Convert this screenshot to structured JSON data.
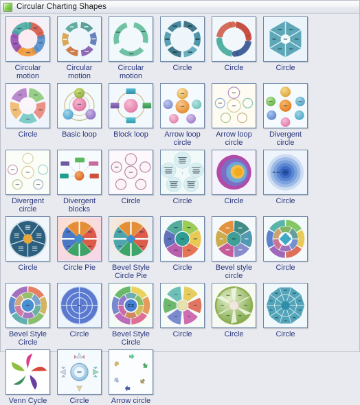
{
  "window": {
    "title": "Circular Charting Shapes",
    "icon": "shapes-library-icon"
  },
  "colors": {
    "background": "#e8eaef",
    "label_text": "#29357e",
    "thumb_border": "#6e87a8",
    "title_text": "#1b1b1b",
    "title_icon_green": "#4ea32a"
  },
  "gallery": {
    "columns": 7,
    "items": [
      {
        "label": "Circular motion",
        "art": "arrow-cycle-4color"
      },
      {
        "label": "Circular motion",
        "art": "arrow-cycle-segments"
      },
      {
        "label": "Circular motion",
        "art": "arc-cycle-green"
      },
      {
        "label": "Circle",
        "art": "segmented-ring-teal"
      },
      {
        "label": "Circle",
        "art": "arrow-ring-4color"
      },
      {
        "label": "Circle",
        "art": "hexagon-radial-teal"
      },
      {
        "label": "Circle",
        "art": "petal-ring-pastel"
      },
      {
        "label": "Basic loop",
        "art": "basic-loop-3node"
      },
      {
        "label": "Block loop",
        "art": "block-loop-4block"
      },
      {
        "label": "Arrow loop circle",
        "art": "arrow-loop-spheres"
      },
      {
        "label": "Arrow loop circle",
        "art": "arrow-loop-outline"
      },
      {
        "label": "Divergent circle",
        "art": "divergent-spheres"
      },
      {
        "label": "Divergent circle",
        "art": "divergent-outline"
      },
      {
        "label": "Divergent blocks",
        "art": "divergent-blocks"
      },
      {
        "label": "Circle",
        "art": "outline-circle-cluster"
      },
      {
        "label": "Circle",
        "art": "text-bubble-cluster"
      },
      {
        "label": "Circle",
        "art": "concentric-rainbow"
      },
      {
        "label": "Circle",
        "art": "concentric-blue"
      },
      {
        "label": "Circle",
        "art": "spoked-wheel-navy"
      },
      {
        "label": "Circle Pie",
        "art": "pie-4-quadrant"
      },
      {
        "label": "Bevel Style Circle Pie",
        "art": "pie-4-quadrant-bevel"
      },
      {
        "label": "Circle",
        "art": "donut-6-rainbow"
      },
      {
        "label": "Bevel style circle",
        "art": "donut-6-bevel"
      },
      {
        "label": "Circle",
        "art": "layered-diamond-wheel"
      },
      {
        "label": "Bevel Style Circle",
        "art": "double-ring-bevel"
      },
      {
        "label": "Circle",
        "art": "target-rings-blue"
      },
      {
        "label": "Bevel Style Circle",
        "art": "double-ring-rainbow"
      },
      {
        "label": "Circle",
        "art": "pinwheel-petals"
      },
      {
        "label": "Circle",
        "art": "wheel-spokes-green"
      },
      {
        "label": "Circle",
        "art": "polygon-web-teal"
      },
      {
        "label": "Venn Cycle",
        "art": "pinwheel-blades-color"
      },
      {
        "label": "Circle",
        "art": "compass-arrows"
      },
      {
        "label": "Arrow circle",
        "art": "scattered-arrows"
      }
    ]
  }
}
